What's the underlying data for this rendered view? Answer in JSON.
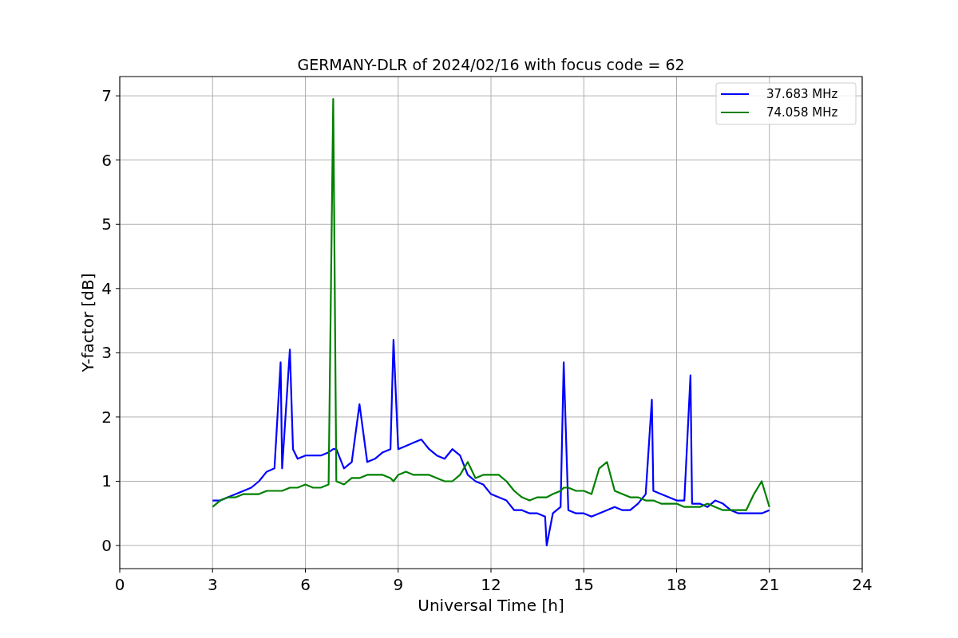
{
  "figure": {
    "chart_data": {
      "type": "line",
      "title": "GERMANY-DLR of 2024/02/16 with focus code = 62",
      "xlabel": "Universal Time [h]",
      "ylabel": "Y-factor [dB]",
      "x": [
        3,
        3.25,
        3.5,
        3.75,
        4,
        4.25,
        4.5,
        4.75,
        5,
        5.2,
        5.25,
        5.5,
        5.6,
        5.75,
        6,
        6.25,
        6.5,
        6.75,
        6.9,
        7,
        7.25,
        7.5,
        7.75,
        8,
        8.25,
        8.5,
        8.75,
        8.85,
        9,
        9.25,
        9.5,
        9.75,
        10,
        10.25,
        10.5,
        10.75,
        11,
        11.25,
        11.5,
        11.75,
        12,
        12.25,
        12.5,
        12.75,
        13,
        13.25,
        13.5,
        13.75,
        13.8,
        14,
        14.25,
        14.35,
        14.5,
        14.75,
        15,
        15.25,
        15.5,
        15.75,
        16,
        16.25,
        16.5,
        16.75,
        17,
        17.2,
        17.25,
        17.5,
        17.75,
        18,
        18.25,
        18.45,
        18.5,
        18.75,
        19,
        19.25,
        19.5,
        19.75,
        20,
        20.25,
        20.5,
        20.75,
        21
      ],
      "series": [
        {
          "name": "37.683 MHz",
          "color": "#0000ff",
          "values": [
            0.7,
            0.7,
            0.75,
            0.8,
            0.85,
            0.9,
            1.0,
            1.15,
            1.2,
            2.85,
            1.2,
            3.05,
            1.5,
            1.35,
            1.4,
            1.4,
            1.4,
            1.45,
            1.5,
            1.5,
            1.2,
            1.3,
            2.2,
            1.3,
            1.35,
            1.45,
            1.5,
            3.2,
            1.5,
            1.55,
            1.6,
            1.65,
            1.5,
            1.4,
            1.35,
            1.5,
            1.4,
            1.1,
            1.0,
            0.95,
            0.8,
            0.75,
            0.7,
            0.55,
            0.55,
            0.5,
            0.5,
            0.45,
            0.0,
            0.5,
            0.6,
            2.85,
            0.55,
            0.5,
            0.5,
            0.45,
            0.5,
            0.55,
            0.6,
            0.55,
            0.55,
            0.65,
            0.8,
            2.27,
            0.85,
            0.8,
            0.75,
            0.7,
            0.7,
            2.65,
            0.65,
            0.65,
            0.6,
            0.7,
            0.65,
            0.55,
            0.5,
            0.5,
            0.5,
            0.5,
            0.55
          ]
        },
        {
          "name": "74.058 MHz",
          "color": "#008000",
          "values": [
            0.6,
            0.7,
            0.75,
            0.75,
            0.8,
            0.8,
            0.8,
            0.85,
            0.85,
            0.85,
            0.85,
            0.9,
            0.9,
            0.9,
            0.95,
            0.9,
            0.9,
            0.95,
            6.95,
            1.0,
            0.95,
            1.05,
            1.05,
            1.1,
            1.1,
            1.1,
            1.05,
            1.0,
            1.1,
            1.15,
            1.1,
            1.1,
            1.1,
            1.05,
            1.0,
            1.0,
            1.1,
            1.3,
            1.05,
            1.1,
            1.1,
            1.1,
            1.0,
            0.85,
            0.75,
            0.7,
            0.75,
            0.75,
            0.75,
            0.8,
            0.85,
            0.9,
            0.9,
            0.85,
            0.85,
            0.8,
            1.2,
            1.3,
            0.85,
            0.8,
            0.75,
            0.75,
            0.7,
            0.7,
            0.7,
            0.65,
            0.65,
            0.65,
            0.6,
            0.6,
            0.6,
            0.6,
            0.65,
            0.6,
            0.55,
            0.55,
            0.55,
            0.55,
            0.8,
            1.0,
            0.6
          ]
        }
      ],
      "xlim": [
        0,
        24
      ],
      "ylim": [
        -0.36,
        7.3
      ],
      "grid": true,
      "legend": "upper right",
      "xticks": [
        0,
        3,
        6,
        9,
        12,
        15,
        18,
        21,
        24
      ],
      "yticks": [
        0,
        1,
        2,
        3,
        4,
        5,
        6,
        7
      ]
    }
  }
}
